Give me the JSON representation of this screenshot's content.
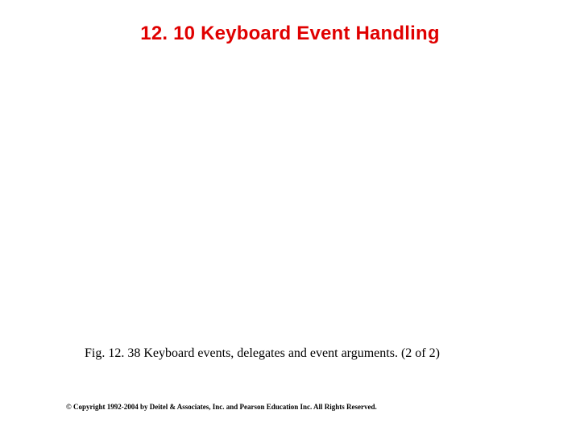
{
  "title": "12. 10  Keyboard Event Handling",
  "caption": "Fig. 12. 38 Keyboard events, delegates and event arguments.  (2 of 2)",
  "copyright": "© Copyright 1992-2004 by Deitel & Associates, Inc. and Pearson Education Inc. All Rights Reserved."
}
